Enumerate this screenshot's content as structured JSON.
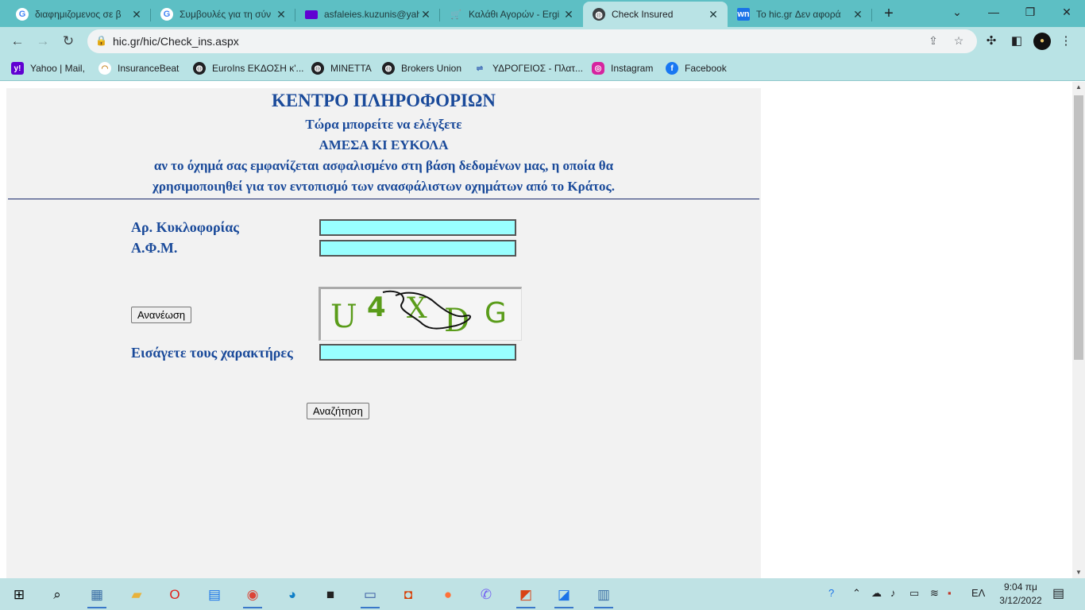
{
  "browser": {
    "tabs": [
      {
        "title": "διαφημιζομενος σε β",
        "icon": "google-icon",
        "active": false
      },
      {
        "title": "Συμβουλές για τη σύν",
        "icon": "google-icon",
        "active": false
      },
      {
        "title": "asfaleies.kuzunis@yah",
        "icon": "yahoo-mail-icon",
        "active": false
      },
      {
        "title": "Καλάθι Αγορών - Ergi",
        "icon": "cart-icon",
        "active": false
      },
      {
        "title": "Check Insured",
        "icon": "globe-icon",
        "active": true
      },
      {
        "title": "Το hic.gr Δεν αφορά",
        "icon": "wn-icon",
        "active": false
      }
    ],
    "url": "hic.gr/hic/Check_ins.aspx",
    "bookmarks": [
      {
        "label": "Yahoo | Mail,",
        "icon": "yahoo-icon"
      },
      {
        "label": "InsuranceBeat",
        "icon": "insurancebeat-icon"
      },
      {
        "label": "EuroIns ΕΚΔΟΣΗ κ'...",
        "icon": "globe-icon"
      },
      {
        "label": "MINETTA",
        "icon": "globe-icon"
      },
      {
        "label": "Brokers Union",
        "icon": "globe-icon"
      },
      {
        "label": "ΥΔΡΟΓΕΙΟΣ - Πλατ...",
        "icon": "hydrogeios-icon"
      },
      {
        "label": "Instagram",
        "icon": "instagram-icon"
      },
      {
        "label": "Facebook",
        "icon": "facebook-icon"
      }
    ]
  },
  "page": {
    "title": "ΚΕΝΤΡΟ ΠΛΗΡΟΦΟΡΙΩΝ",
    "subtitle1": "Τώρα μπορείτε να ελέγξετε",
    "subtitle2": "ΑΜΕΣΑ ΚΙ ΕΥΚΟΛΑ",
    "description1": "αν το όχημά σας εμφανίζεται ασφαλισμένο στη βάση δεδομένων μας, η οποία θα",
    "description2": "χρησιμοποιηθεί για τον εντοπισμό των ανασφάλιστων οχημάτων από το Κράτος.",
    "form": {
      "plate_label": "Αρ. Κυκλοφορίας",
      "plate_value": "",
      "afm_label": "Α.Φ.Μ.",
      "afm_value": "",
      "refresh_label": "Ανανέωση",
      "captcha_text": [
        "U",
        "4",
        "X",
        "D",
        "G"
      ],
      "captcha_label": "Εισάγετε τους χαρακτήρες",
      "captcha_value": "",
      "search_label": "Αναζήτηση"
    },
    "colors": {
      "heading": "#1a4a9a",
      "input_bg": "#99ffff",
      "panel_bg": "#f2f2f2",
      "captcha_text": "#5a9c1a"
    }
  },
  "taskbar": {
    "apps": [
      "windows-icon",
      "search-icon",
      "calculator-icon",
      "file-explorer-icon",
      "opera-icon",
      "calendar-icon",
      "chrome-icon",
      "edge-icon",
      "sticky-notes-icon",
      "network-app-icon",
      "office-icon",
      "firefox-icon",
      "viber-icon",
      "app-icon",
      "pdf-icon",
      "notepad-icon"
    ],
    "language": "ΕΛ",
    "time": "9:04 πμ",
    "date": "3/12/2022"
  }
}
